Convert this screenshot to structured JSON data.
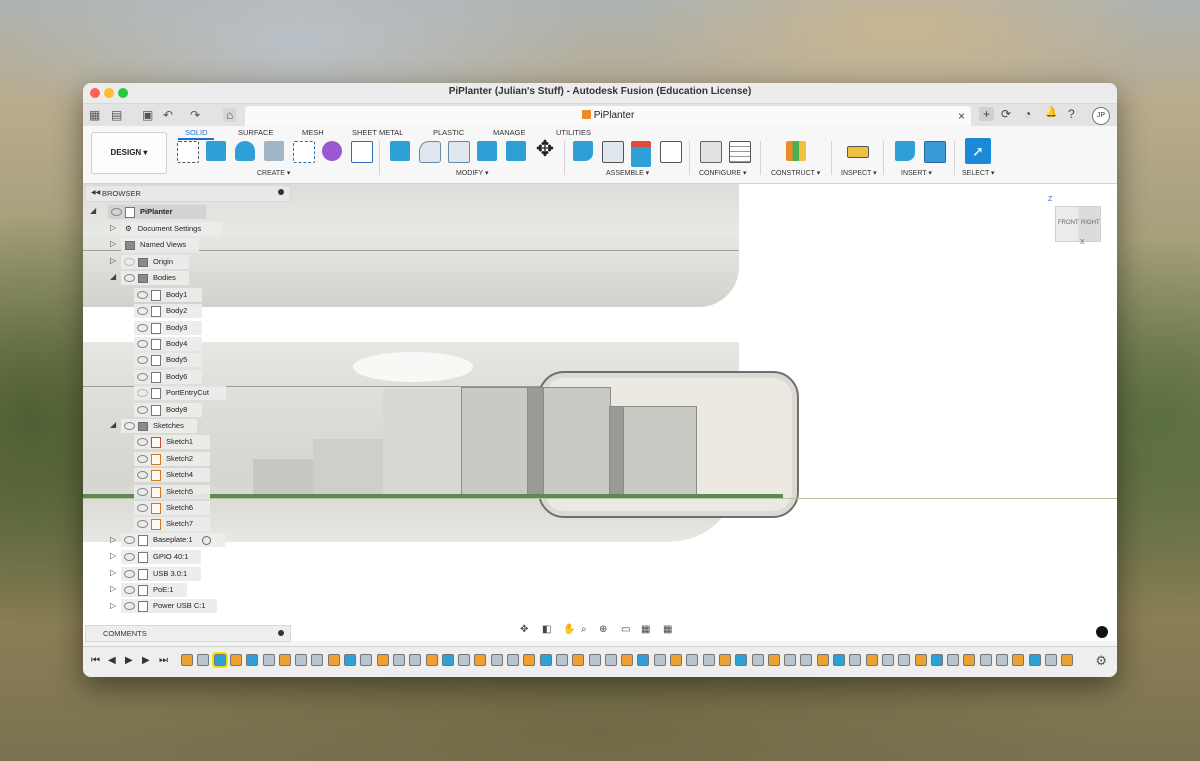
{
  "window": {
    "title": "PiPlanter (Julian's Stuff) - Autodesk Fusion (Education License)"
  },
  "document_tab": {
    "name": "PiPlanter",
    "close": "×"
  },
  "quick_access": {
    "grid": "▦",
    "file": "▤",
    "save": "▣",
    "undo": "↶",
    "redo": "↷",
    "home": "⌂"
  },
  "right_icons": {
    "add": "+",
    "online": "⟳",
    "jobs": "◔",
    "notifications": "🔔",
    "help": "?"
  },
  "user": {
    "initials": "JP"
  },
  "workspace": {
    "label": "DESIGN ▾"
  },
  "toolbar_tabs": [
    "SOLID",
    "SURFACE",
    "MESH",
    "SHEET METAL",
    "PLASTIC",
    "MANAGE",
    "UTILITIES"
  ],
  "groups": {
    "create": "CREATE ▾",
    "modify": "MODIFY ▾",
    "assemble": "ASSEMBLE ▾",
    "configure": "CONFIGURE ▾",
    "construct": "CONSTRUCT ▾",
    "inspect": "INSPECT ▾",
    "insert": "INSERT ▾",
    "select": "SELECT ▾"
  },
  "colors": {
    "accent": "#1a73c9",
    "orange": "#f08a24",
    "teal": "#2f9fd8",
    "green": "#4caf50"
  },
  "browser": {
    "header": "BROWSER",
    "root": "PiPlanter",
    "items": [
      "Document Settings",
      "Named Views",
      "Origin",
      "Bodies",
      "Body1",
      "Body2",
      "Body3",
      "Body4",
      "Body5",
      "Body6",
      "PortEntryCut",
      "Body8",
      "Sketches",
      "Sketch1",
      "Sketch2",
      "Sketch4",
      "Sketch5",
      "Sketch6",
      "Sketch7",
      "Baseplate:1",
      "GPIO 40:1",
      "USB 3.0:1",
      "PoE:1",
      "Power USB C:1"
    ]
  },
  "comments": {
    "label": "COMMENTS"
  },
  "viewcube": {
    "front": "FRONT",
    "right": "RIGHT",
    "z": "Z",
    "x": "X"
  },
  "timeline": {
    "first": "⏮",
    "prev": "◀",
    "play": "▶",
    "next": "▶",
    "last": "⏭",
    "settings": "⚙"
  },
  "nav_tools": {
    "orbit": "✥",
    "look": "◧",
    "pan": "✋",
    "zoom": "⌕",
    "fit": "⊕",
    "display": "▭",
    "visual": "▦",
    "grid": "▦"
  }
}
